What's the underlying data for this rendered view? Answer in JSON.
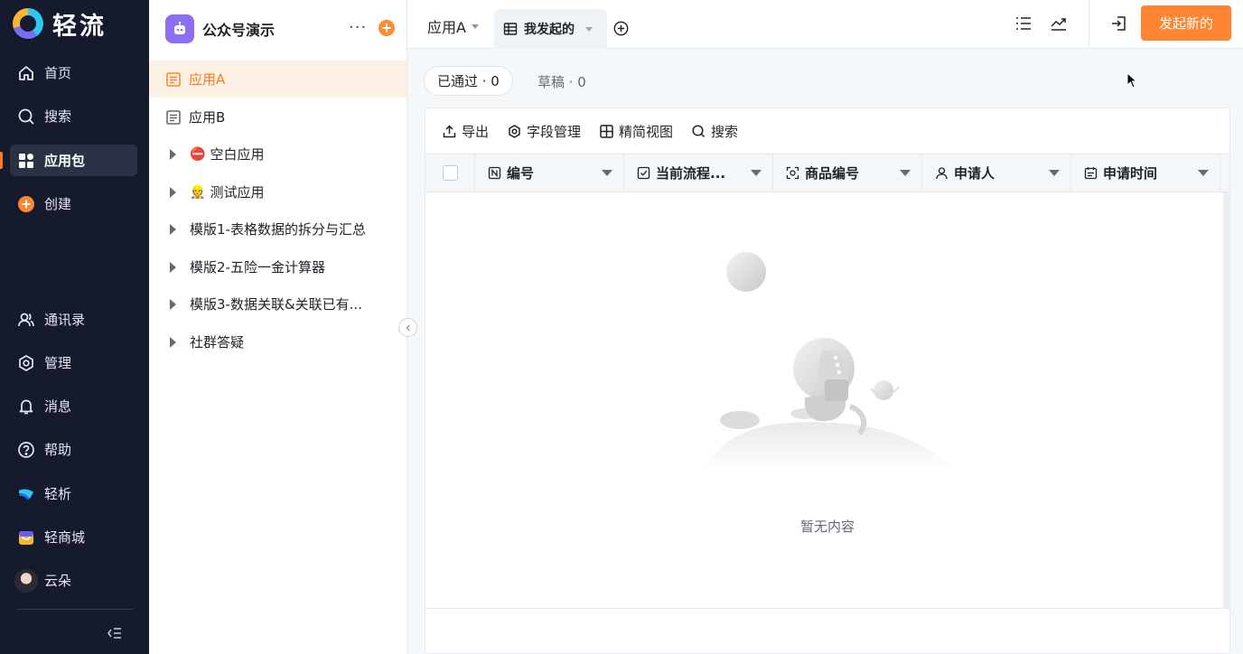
{
  "brand": {
    "name": "轻流"
  },
  "nav": {
    "top_items": [
      {
        "label": "首页",
        "icon": "home-icon"
      },
      {
        "label": "搜索",
        "icon": "search-icon"
      },
      {
        "label": "应用包",
        "icon": "grid-icon",
        "active": true
      },
      {
        "label": "创建",
        "icon": "plus-circle-icon"
      }
    ],
    "bottom_items": [
      {
        "label": "通讯录",
        "icon": "contacts-icon"
      },
      {
        "label": "管理",
        "icon": "hexagon-gear-icon"
      },
      {
        "label": "消息",
        "icon": "bell-icon"
      },
      {
        "label": "帮助",
        "icon": "help-icon"
      },
      {
        "label": "轻析",
        "icon": "analytics-icon"
      },
      {
        "label": "轻商城",
        "icon": "store-icon"
      },
      {
        "label": "云朵",
        "icon": "avatar"
      }
    ]
  },
  "tree": {
    "package_title": "公众号演示",
    "items": [
      {
        "label": "应用A",
        "type": "form",
        "selected": true
      },
      {
        "label": "应用B",
        "type": "form"
      },
      {
        "label": "空白应用",
        "type": "folder",
        "emoji": "⛔"
      },
      {
        "label": "测试应用",
        "type": "folder",
        "emoji": "👷"
      },
      {
        "label": "模版1-表格数据的拆分与汇总",
        "type": "folder"
      },
      {
        "label": "模版2-五险一金计算器",
        "type": "folder"
      },
      {
        "label": "模版3-数据关联&关联已有...",
        "type": "folder"
      },
      {
        "label": "社群答疑",
        "type": "folder"
      }
    ]
  },
  "topbar": {
    "app_name": "应用A",
    "view_tab": "我发起的",
    "start_button": "发起新的"
  },
  "filters": {
    "approved": "已通过 · 0",
    "draft": "草稿 · 0"
  },
  "toolbar": {
    "export": "导出",
    "field_manage": "字段管理",
    "compact_view": "精简视图",
    "search": "搜索"
  },
  "table": {
    "columns": [
      {
        "label": "编号",
        "icon": "number-field-icon"
      },
      {
        "label": "当前流程...",
        "icon": "checkbox-field-icon"
      },
      {
        "label": "商品编号",
        "icon": "scan-field-icon"
      },
      {
        "label": "申请人",
        "icon": "user-field-icon"
      },
      {
        "label": "申请时间",
        "icon": "date-field-icon"
      }
    ],
    "rows": [],
    "empty_text": "暂无内容"
  },
  "colors": {
    "nav_bg": "#151a2c",
    "accent": "#ff8533",
    "selected_bg": "#fdf1e6"
  }
}
